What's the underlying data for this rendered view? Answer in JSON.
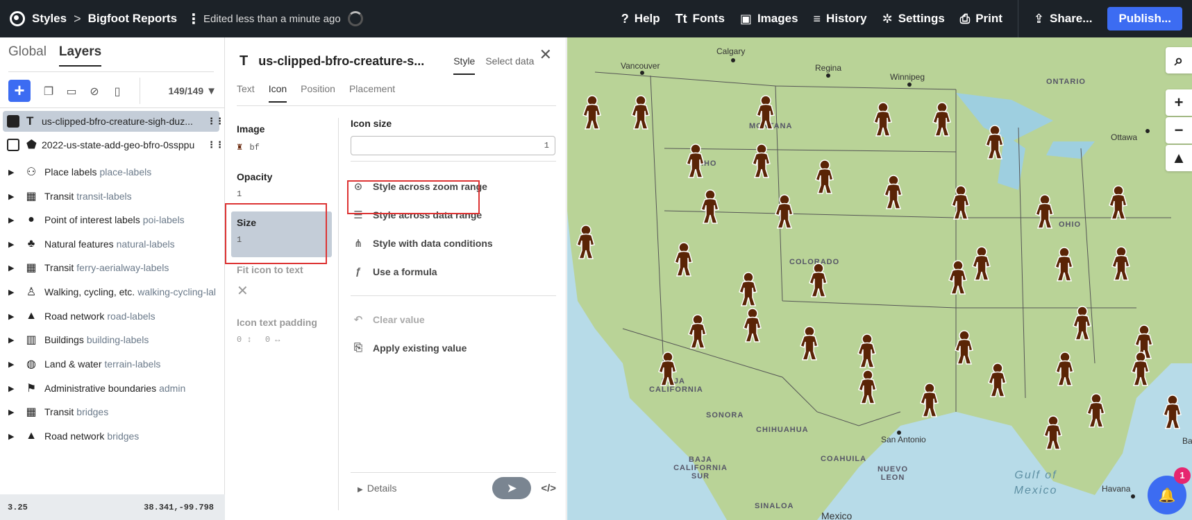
{
  "topbar": {
    "breadcrumb_root": "Styles",
    "breadcrumb_sep": ">",
    "project": "Bigfoot Reports",
    "kebab": "⋮",
    "status": "Edited less than a minute ago",
    "items": [
      {
        "label": "Help",
        "icon": "question-icon",
        "glyph": "?"
      },
      {
        "label": "Fonts",
        "icon": "fonts-icon",
        "glyph": "Tt"
      },
      {
        "label": "Images",
        "icon": "image-icon",
        "glyph": "▣"
      },
      {
        "label": "History",
        "icon": "history-icon",
        "glyph": "≡"
      },
      {
        "label": "Settings",
        "icon": "gear-icon",
        "glyph": "✲"
      },
      {
        "label": "Print",
        "icon": "printer-icon",
        "glyph": "⎙"
      },
      {
        "label": "Share...",
        "icon": "share-icon",
        "glyph": "⇪"
      }
    ],
    "publish": "Publish..."
  },
  "left": {
    "tabs": [
      "Global",
      "Layers"
    ],
    "count": "149/149",
    "selected_layer": {
      "type": "T",
      "name": "us-clipped-bfro-creature-sigh-duz..."
    },
    "second_layer": {
      "type": "⬟",
      "name": "2022-us-state-add-geo-bfro-0ssppu"
    },
    "groups": [
      {
        "icon": "person-label-icon",
        "glyph": "⚇",
        "name": "Place labels",
        "id": "place-labels"
      },
      {
        "icon": "transit-icon",
        "glyph": "▦",
        "name": "Transit",
        "id": "transit-labels"
      },
      {
        "icon": "pin-icon",
        "glyph": "●",
        "name": "Point of interest labels",
        "id": "poi-labels"
      },
      {
        "icon": "trees-icon",
        "glyph": "♣",
        "name": "Natural features",
        "id": "natural-labels"
      },
      {
        "icon": "transit-icon",
        "glyph": "▦",
        "name": "Transit",
        "id": "ferry-aerialway-labels"
      },
      {
        "icon": "walking-icon",
        "glyph": "♙",
        "name": "Walking, cycling, etc.",
        "id": "walking-cycling-lal"
      },
      {
        "icon": "road-icon",
        "glyph": "▲",
        "name": "Road network",
        "id": "road-labels"
      },
      {
        "icon": "building-icon",
        "glyph": "▥",
        "name": "Buildings",
        "id": "building-labels"
      },
      {
        "icon": "globe-icon",
        "glyph": "◍",
        "name": "Land & water",
        "id": "terrain-labels"
      },
      {
        "icon": "flag-icon",
        "glyph": "⚑",
        "name": "Administrative boundaries",
        "id": "admin"
      },
      {
        "icon": "transit-icon",
        "glyph": "▦",
        "name": "Transit",
        "id": "bridges"
      },
      {
        "icon": "road-icon",
        "glyph": "▲",
        "name": "Road network",
        "id": "bridges"
      }
    ],
    "zoom": "3.25",
    "coords": "38.341,-99.798"
  },
  "editor": {
    "title": "us-clipped-bfro-creature-s...",
    "tab_style": "Style",
    "tab_select": "Select data",
    "subtabs": [
      "Text",
      "Icon",
      "Position",
      "Placement"
    ],
    "props": {
      "image_label": "Image",
      "image_value": "bf",
      "opacity_label": "Opacity",
      "opacity_value": "1",
      "size_label": "Size",
      "size_value": "1",
      "fit_label": "Fit icon to text",
      "padding_label": "Icon text padding",
      "padding_v": "0",
      "padding_h": "0"
    },
    "icon_size_label": "Icon size",
    "icon_size_value": "1",
    "options": [
      "Style across zoom range",
      "Style across data range",
      "Style with data conditions",
      "Use a formula"
    ],
    "clear": "Clear value",
    "apply": "Apply existing value",
    "details": "Details"
  },
  "map": {
    "cities": [
      "Vancouver",
      "Calgary",
      "Regina",
      "Winnipeg",
      "Ottawa",
      "San Antonio",
      "Havana",
      "Mexico"
    ],
    "states": [
      "ONTARIO",
      "MONTANA",
      "IDAHO",
      "COLORADO",
      "OHIO"
    ],
    "regions": [
      "BAJA CALIFORNIA",
      "SONORA",
      "CHIHUAHUA",
      "COAHUILA",
      "BAJA CALIFORNIA SUR",
      "NUEVO LEON",
      "SINALOA"
    ],
    "sea": "Gulf of Mexico",
    "edge_label": "Ba",
    "notifications": "1"
  }
}
